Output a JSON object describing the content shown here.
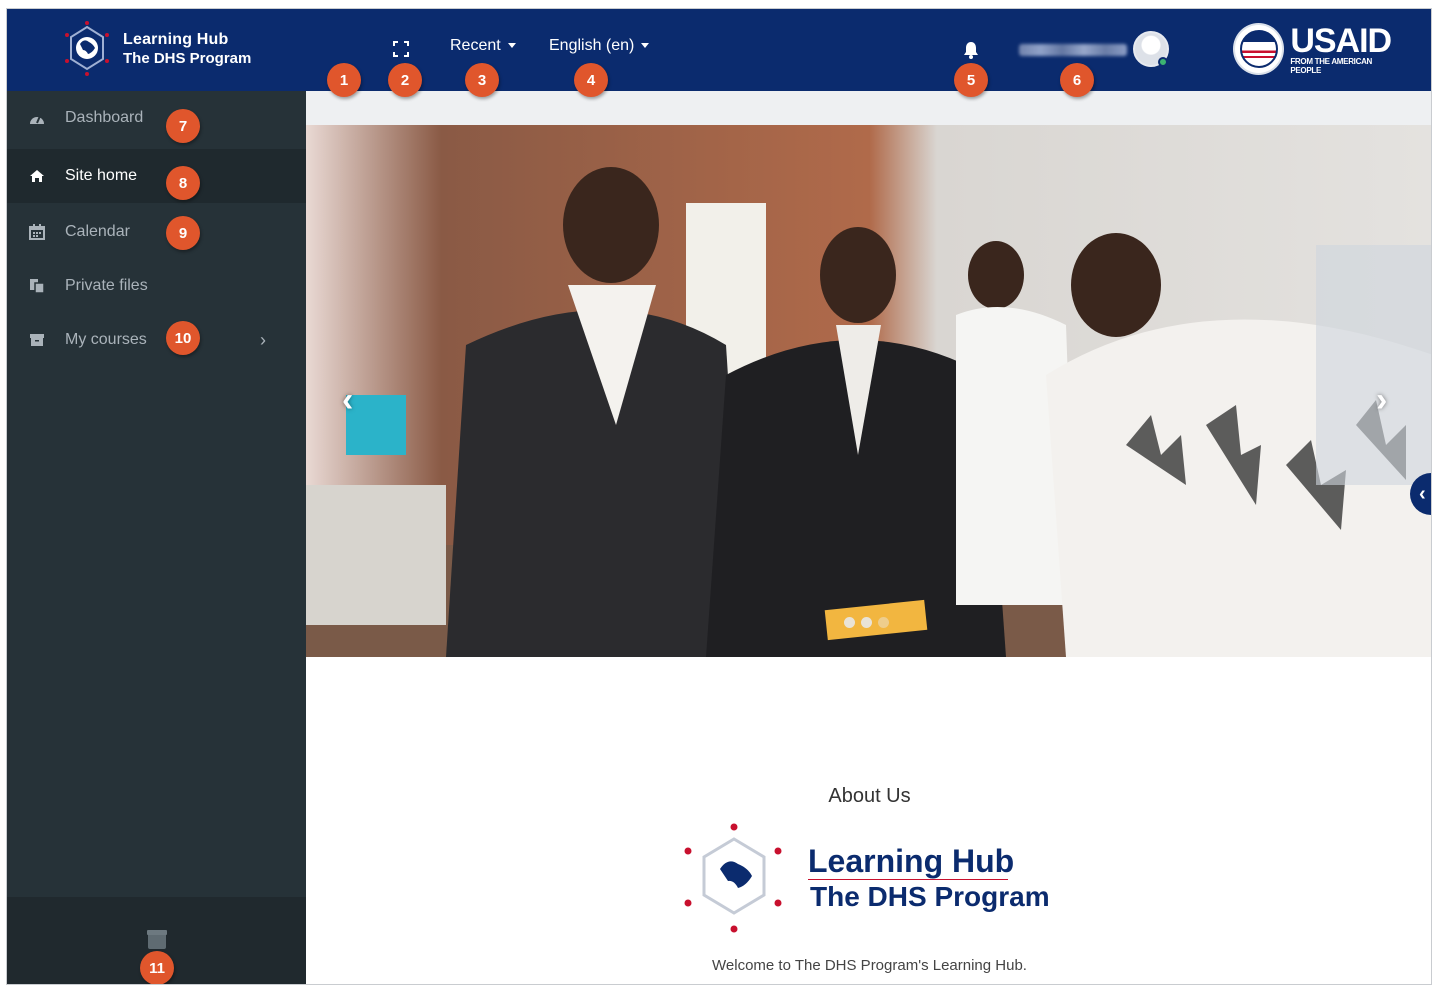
{
  "brand": {
    "line1": "Learning Hub",
    "line2": "The DHS Program"
  },
  "navbar": {
    "recent_label": "Recent",
    "language_label": "English (en)",
    "usaid_word": "USAID",
    "usaid_tagline": "FROM THE AMERICAN PEOPLE"
  },
  "badges": [
    "1",
    "2",
    "3",
    "4",
    "5",
    "6",
    "7",
    "8",
    "9",
    "10",
    "11"
  ],
  "sidebar": {
    "items": [
      {
        "label": "Dashboard",
        "icon": "dashboard-icon"
      },
      {
        "label": "Site home",
        "icon": "home-icon"
      },
      {
        "label": "Calendar",
        "icon": "calendar-icon"
      },
      {
        "label": "Private files",
        "icon": "files-icon"
      },
      {
        "label": "My courses",
        "icon": "archive-icon"
      }
    ]
  },
  "carousel": {
    "slide_count": 3,
    "active_slide": 1
  },
  "about": {
    "title": "About Us",
    "logo_line1": "Learning Hub",
    "logo_line2": "The DHS Program",
    "welcome": "Welcome to The DHS Program's Learning Hub."
  },
  "colors": {
    "navbar": "#0b2b6e",
    "sidebar": "#263238",
    "badge": "#e0562c",
    "brand_red": "#c8102e"
  }
}
